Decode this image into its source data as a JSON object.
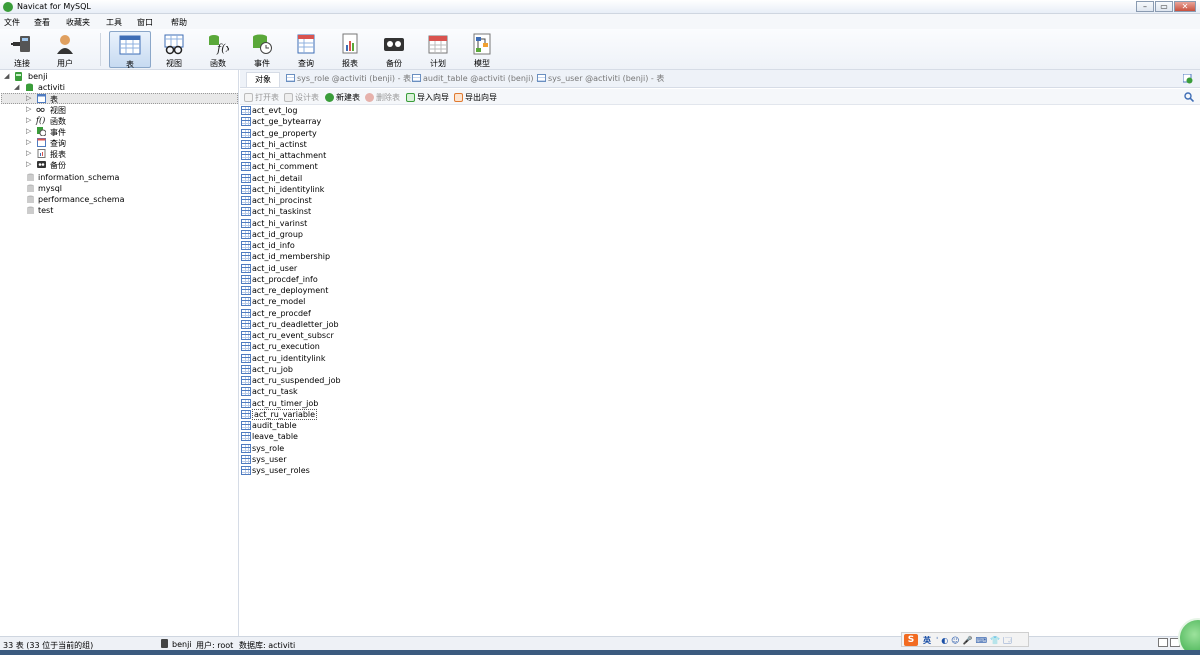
{
  "window": {
    "title": "Navicat for MySQL",
    "buttons": [
      "–",
      "▭",
      "✕"
    ]
  },
  "menu": [
    "文件",
    "查看",
    "收藏夹",
    "工具",
    "窗口",
    "帮助"
  ],
  "toolbar": [
    {
      "label": "连接",
      "icon": "plug-icon"
    },
    {
      "label": "用户",
      "icon": "user-icon"
    },
    {
      "label": "表",
      "icon": "table-icon",
      "active": true
    },
    {
      "label": "视图",
      "icon": "glasses-icon"
    },
    {
      "label": "函数",
      "icon": "function-icon"
    },
    {
      "label": "事件",
      "icon": "event-icon"
    },
    {
      "label": "查询",
      "icon": "query-icon"
    },
    {
      "label": "报表",
      "icon": "report-icon"
    },
    {
      "label": "备份",
      "icon": "backup-icon"
    },
    {
      "label": "计划",
      "icon": "calendar-icon"
    },
    {
      "label": "模型",
      "icon": "model-icon"
    }
  ],
  "tree": {
    "connection": "benji",
    "database": "activiti",
    "nodes": [
      "表",
      "视图",
      "函数",
      "事件",
      "查询",
      "报表",
      "备份"
    ],
    "nodes_f": "f()",
    "other_databases": [
      "information_schema",
      "mysql",
      "performance_schema",
      "test"
    ]
  },
  "tabs": {
    "objects": "对象",
    "open": [
      "sys_role @activiti (benji) - 表",
      "audit_table @activiti (benji) ...",
      "sys_user @activiti (benji) - 表"
    ]
  },
  "actions": {
    "open_table": "打开表",
    "design_table": "设计表",
    "new_table": "新建表",
    "delete_table": "删除表",
    "import_wizard": "导入向导",
    "export_wizard": "导出向导"
  },
  "tables": [
    "act_evt_log",
    "act_ge_bytearray",
    "act_ge_property",
    "act_hi_actinst",
    "act_hi_attachment",
    "act_hi_comment",
    "act_hi_detail",
    "act_hi_identitylink",
    "act_hi_procinst",
    "act_hi_taskinst",
    "act_hi_varinst",
    "act_id_group",
    "act_id_info",
    "act_id_membership",
    "act_id_user",
    "act_procdef_info",
    "act_re_deployment",
    "act_re_model",
    "act_re_procdef",
    "act_ru_deadletter_job",
    "act_ru_event_subscr",
    "act_ru_execution",
    "act_ru_identitylink",
    "act_ru_job",
    "act_ru_suspended_job",
    "act_ru_task",
    "act_ru_timer_job",
    "act_ru_variable",
    "audit_table",
    "leave_table",
    "sys_role",
    "sys_user",
    "sys_user_roles"
  ],
  "selected_table": "act_ru_variable",
  "status": {
    "count": "33 表 (33 位于当前的组)",
    "connection": "benji",
    "user": "用户: root",
    "database": "数据库: activiti"
  },
  "ime": {
    "logo": "S",
    "lang": "英",
    "icons": "ˈ◐☺🎤⌨👕🗔"
  },
  "colors": {
    "accent": "#4f7bc0",
    "selection": "#c7daf1",
    "ime_orange": "#f26b21",
    "db_green": "#3a9d3a"
  }
}
